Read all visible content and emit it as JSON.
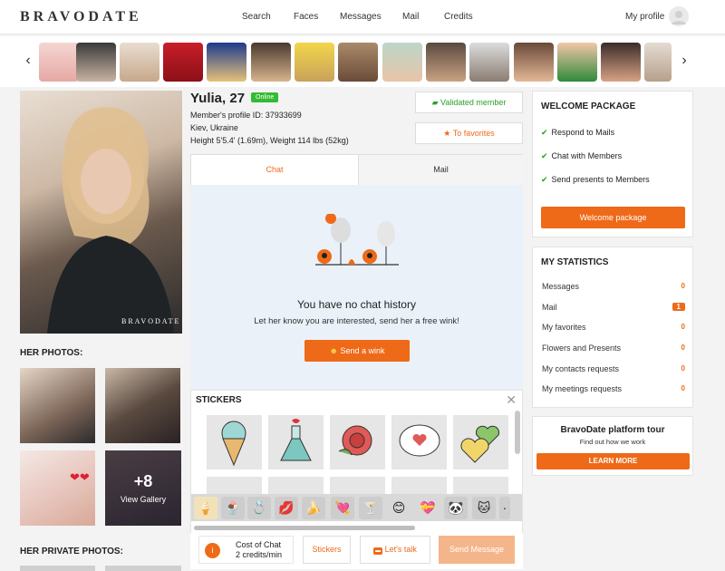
{
  "header": {
    "logo": "BRAVODATE",
    "nav": [
      "Search",
      "Faces",
      "Messages",
      "Mail",
      "Credits"
    ],
    "my_profile": "My profile"
  },
  "carousel": {
    "prev_icon": "chevron-left-icon",
    "next_icon": "chevron-right-icon",
    "count": 15
  },
  "profile": {
    "name_age": "Yulia, 27",
    "online": "Online",
    "id_line": "Member's profile ID: 37933699",
    "location": "Kiev, Ukraine",
    "height_weight": "Height 5'5.4' (1.69m), Weight 114 lbs (52kg)",
    "validated": "Validated member",
    "favorites": "To favorites",
    "watermark": "BRAVODATE"
  },
  "photos": {
    "her_photos": "HER PHOTOS:",
    "more_count": "+8",
    "view_gallery": "View Gallery",
    "her_private": "HER PRIVATE PHOTOS:"
  },
  "tabs": {
    "chat": "Chat",
    "mail": "Mail"
  },
  "chat": {
    "empty_title": "You have no chat history",
    "empty_sub": "Let her know you are interested, send her a free wink!",
    "wink_button": "Send a wink"
  },
  "stickers": {
    "title": "STICKERS",
    "close_icon": "close-icon"
  },
  "bottombar": {
    "cost_label": "Cost of Chat",
    "cost_value": "2 credits/min",
    "stickers_btn": "Stickers",
    "letstalk_btn": "Let's talk",
    "send_btn": "Send Message"
  },
  "welcome": {
    "title": "WELCOME PACKAGE",
    "items": [
      "Respond to Mails",
      "Chat with Members",
      "Send presents to Members"
    ],
    "button": "Welcome package"
  },
  "stats": {
    "title": "MY STATISTICS",
    "rows": [
      {
        "label": "Messages",
        "count": "0"
      },
      {
        "label": "Mail",
        "count": "1"
      },
      {
        "label": "My favorites",
        "count": "0"
      },
      {
        "label": "Flowers and Presents",
        "count": "0"
      },
      {
        "label": "My contacts requests",
        "count": "0"
      },
      {
        "label": "My meetings requests",
        "count": "0"
      }
    ]
  },
  "tour": {
    "title": "BravoDate platform tour",
    "sub": "Find out how we work",
    "button": "LEARN MORE"
  },
  "colors": {
    "accent": "#EE6A18",
    "online": "#33BB33",
    "check": "#2AA12A"
  }
}
